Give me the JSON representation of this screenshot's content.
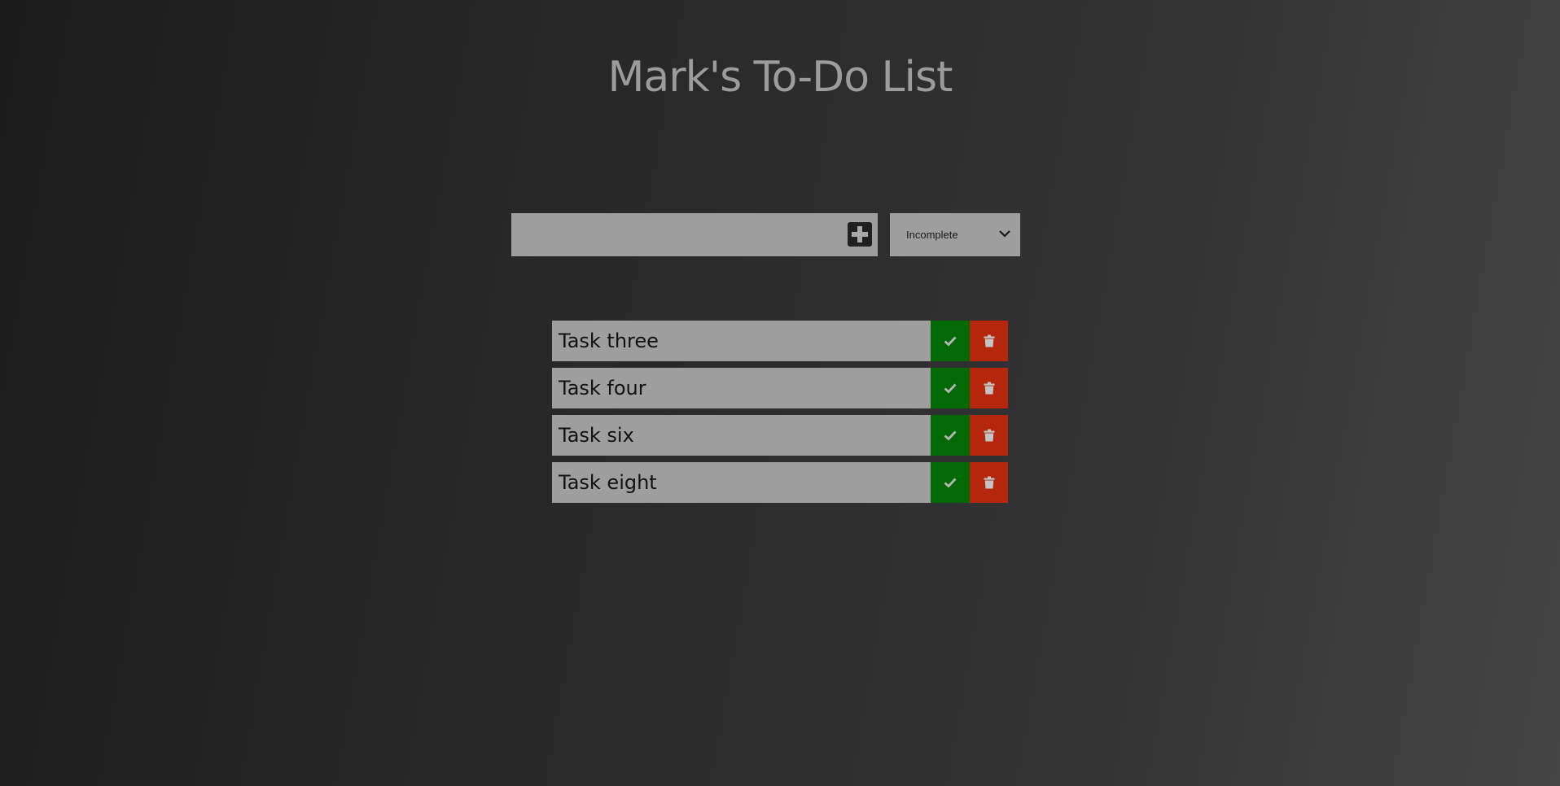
{
  "header": {
    "title": "Mark's To-Do List"
  },
  "add_form": {
    "input_value": "",
    "input_placeholder": "",
    "add_icon": "plus-square-icon"
  },
  "filter": {
    "selected": "Incomplete",
    "icon": "chevron-down-icon"
  },
  "todos": [
    {
      "text": "Task three"
    },
    {
      "text": "Task four"
    },
    {
      "text": "Task six"
    },
    {
      "text": "Task eight"
    }
  ],
  "icons": {
    "complete": "check-icon",
    "delete": "trash-icon"
  },
  "colors": {
    "complete": "#036904",
    "delete": "#b4270d",
    "item_background": "#9e9e9e",
    "title": "#9c9c9c"
  }
}
